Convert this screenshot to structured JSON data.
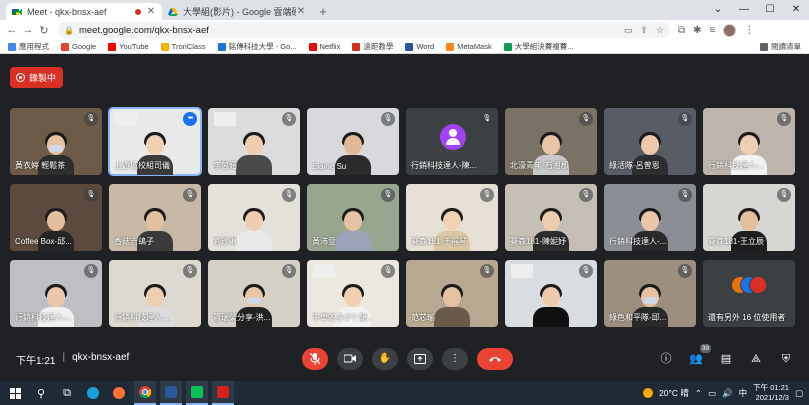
{
  "browser": {
    "tabs": [
      {
        "title": "Meet - qkx-bnsx-aef",
        "active": true,
        "recording": true
      },
      {
        "title": "大學組(影片) - Google 雲端硬碟",
        "active": false
      }
    ],
    "url": "meet.google.com/qkx-bnsx-aef",
    "bookmarks": [
      {
        "label": "應用程式",
        "color": "#4285f4"
      },
      {
        "label": "Google",
        "color": "#ea4335"
      },
      {
        "label": "YouTube",
        "color": "#ff0000"
      },
      {
        "label": "TronClass",
        "color": "#f4b400"
      },
      {
        "label": "銘傳科技大學 - Go...",
        "color": "#1a73e8"
      },
      {
        "label": "Netflix",
        "color": "#e50914"
      },
      {
        "label": "遠距教學",
        "color": "#d93025"
      },
      {
        "label": "Word",
        "color": "#2b579a"
      },
      {
        "label": "MetaMask",
        "color": "#f6851b"
      },
      {
        "label": "大學組決賽複賽...",
        "color": "#0f9d58"
      }
    ],
    "reading_list": "閱讀清單"
  },
  "meet": {
    "recording_label": "錄製中",
    "time": "下午1:21",
    "separator": "|",
    "meeting_code": "qkx-bnsx-aef",
    "participant_count": "39",
    "controls": {
      "mic": "mic-off",
      "camera": "camera",
      "hand": "raise-hand",
      "present": "present",
      "more": "more",
      "end": "end-call"
    }
  },
  "tiles": [
    {
      "name": "黃衣婷 輕鬆茶",
      "bg": "#6d5a47",
      "skin": "#e6c3a5",
      "shirt": "#2d2d2d",
      "mask": true
    },
    {
      "name": "上遊城校組司儀",
      "bg": "#e9e9e9",
      "skin": "#f0cfb3",
      "shirt": "#3a3a3a",
      "speaking": true,
      "sign": true
    },
    {
      "name": "李茵涵",
      "bg": "#dcdcdc",
      "skin": "#efcdb0",
      "shirt": "#4a4a4a",
      "sign": true
    },
    {
      "name": "Elaine Su",
      "bg": "#d7d9dc",
      "skin": "#e2b996",
      "shirt": "#2b2b2b"
    },
    {
      "name": "行銷科技達人-陳...",
      "bg": "#3c4043",
      "avatar": true
    },
    {
      "name": "北濠青年-石湘郡",
      "bg": "#7a7365",
      "skin": "#e8c5a7",
      "shirt": "#c9c9c9"
    },
    {
      "name": "綠活隊-呂曾恩",
      "bg": "#585c65",
      "skin": "#ecc9ab",
      "shirt": "#2e2e2e"
    },
    {
      "name": "行銷科技達人-...",
      "bg": "#bdb5ac",
      "skin": "#efcfb3",
      "shirt": "#f2f2f2"
    },
    {
      "name": "Coffee Box-邱...",
      "bg": "#5b4a3d",
      "skin": "#e3bf9f",
      "shirt": "#252525"
    },
    {
      "name": "香菇吉鴿子",
      "bg": "#c8b9a6",
      "skin": "#e5c09e",
      "shirt": "#3a3a3a"
    },
    {
      "name": "劉珍琳",
      "bg": "#e4e0da",
      "skin": "#efcdb0",
      "shirt": "#e8e8e8"
    },
    {
      "name": "黃沛萱",
      "bg": "#98a58f",
      "skin": "#e6c2a3",
      "shirt": "#9aa3b8"
    },
    {
      "name": "賽森181-于福琴",
      "bg": "#e6e0d4",
      "skin": "#f2d2b4",
      "shirt": "#d9c7a6"
    },
    {
      "name": "賽森181-陳妮妤",
      "bg": "#c4beb4",
      "skin": "#edcbae",
      "shirt": "#2c2c2c"
    },
    {
      "name": "行銷科技達人-...",
      "bg": "#8b8e94",
      "skin": "#e8c6a8",
      "shirt": "#2a2a2a"
    },
    {
      "name": "賽森181-王立辰",
      "bg": "#d8d6d2",
      "skin": "#e4bf9f",
      "shirt": "#1e1e1e"
    },
    {
      "name": "行銷科技達人-...",
      "bg": "#bdbfc2",
      "skin": "#ebc8aa",
      "shirt": "#f0f0f0"
    },
    {
      "name": "行銷科技達人-...",
      "bg": "#ddd8d0",
      "skin": "#efcfb3",
      "shirt": "#dcdcdc"
    },
    {
      "name": "蕭瑞榮分享-洪...",
      "bg": "#d4cfc7",
      "skin": "#e9c6a6",
      "shirt": "#222222",
      "mask": true
    },
    {
      "name": "牛車的多少? 胡...",
      "bg": "#ece7df",
      "skin": "#f0cfb3",
      "shirt": "#f2f2f2",
      "sign": true
    },
    {
      "name": "范芯瑜",
      "bg": "#b8a891",
      "skin": "#e6c2a2",
      "shirt": "#6a5a4a"
    },
    {
      "name": "",
      "bg": "#d9dde1",
      "skin": "#eccbad",
      "shirt": "#101010",
      "sign": true
    },
    {
      "name": "綠色和平隊-邱...",
      "bg": "#9c8f80",
      "skin": "#e5c1a1",
      "shirt": "#2a2a2a",
      "mask": true
    },
    {
      "name": "還有另外 16 位使用者",
      "bg": "#3c4043",
      "others": true
    },
    {
      "name": "",
      "bg": "#e7e4df",
      "skin": "#eccaac",
      "shirt": "#1c1c1c",
      "mask": true
    }
  ],
  "taskbar": {
    "weather": "20°C 晴",
    "input_method": "中",
    "clock_time": "下午 01:21",
    "clock_date": "2021/12/3"
  }
}
